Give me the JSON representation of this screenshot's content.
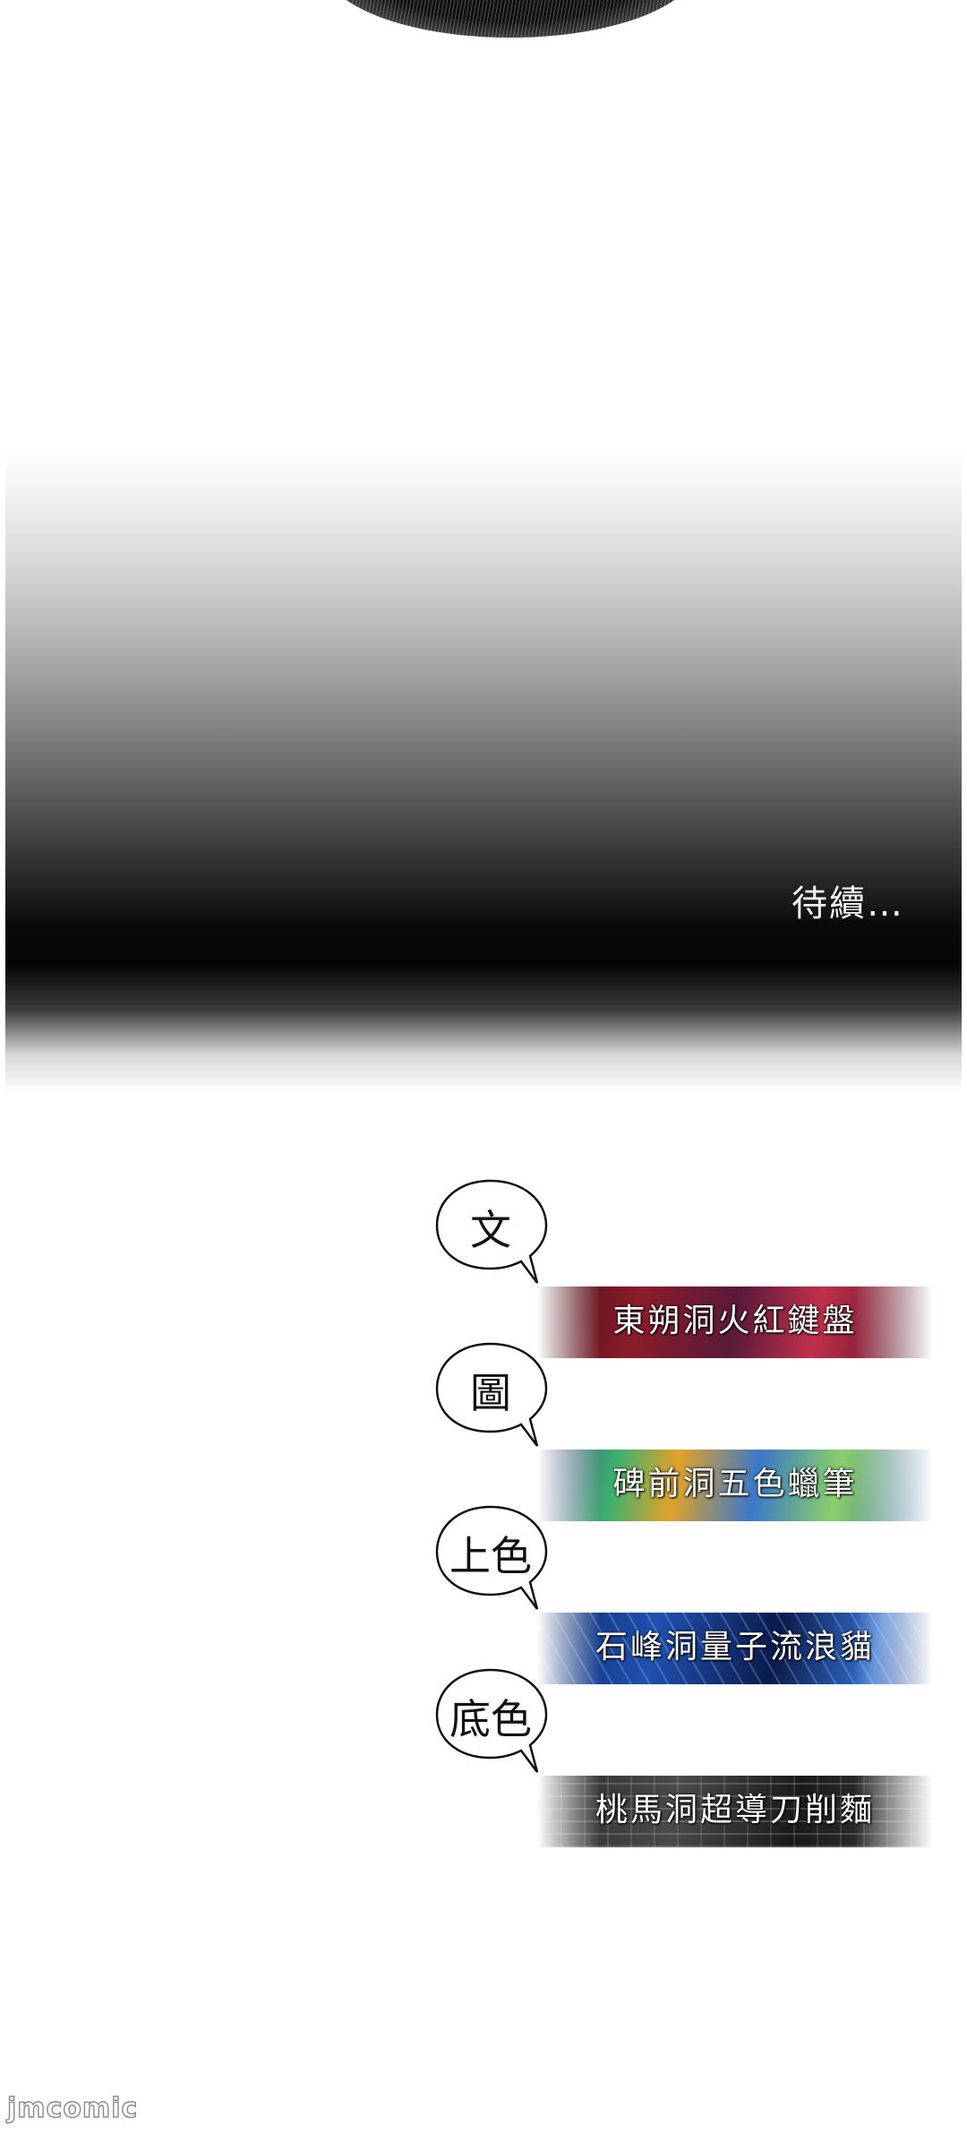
{
  "ending": {
    "to_be_continued": "待續…"
  },
  "credits": [
    {
      "role": "文",
      "studio": "東朔洞火紅鍵盤"
    },
    {
      "role": "圖",
      "studio": "碑前洞五色蠟筆"
    },
    {
      "role": "上色",
      "studio": "石峰洞量子流浪貓"
    },
    {
      "role": "底色",
      "studio": "桃馬洞超導刀削麵"
    }
  ],
  "watermark": {
    "text": "jmcomic"
  },
  "colors": {
    "background": "#ffffff",
    "gradient_dark": "#050505",
    "text_light": "#f2f2f2"
  }
}
